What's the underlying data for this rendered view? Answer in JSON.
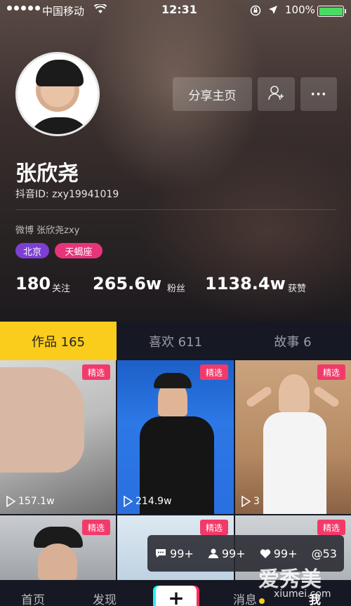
{
  "status_bar": {
    "carrier": "中国移动",
    "time": "12:31",
    "battery": "100%"
  },
  "profile": {
    "name": "张欣尧",
    "douyin_id": "抖音ID: zxy19941019",
    "weibo": "微博 张欣尧zxy",
    "tags": {
      "city": "北京",
      "zodiac": "天蝎座"
    },
    "share_label": "分享主页",
    "more_label": "···",
    "stats": {
      "following": {
        "value": "180",
        "label": "关注"
      },
      "followers": {
        "value": "265.6w",
        "label": "粉丝"
      },
      "likes": {
        "value": "1138.4w",
        "label": "获赞"
      }
    }
  },
  "tabs": {
    "works": "作品 165",
    "likes": "喜欢 611",
    "stories": "故事 6",
    "active": "works"
  },
  "grid": {
    "badge": "精选",
    "tiles": [
      {
        "plays": "157.1w"
      },
      {
        "plays": "214.9w"
      },
      {
        "plays": "3"
      },
      {
        "plays": ""
      },
      {
        "plays": ""
      },
      {
        "plays": ""
      }
    ]
  },
  "notice": {
    "comments": "99+",
    "fans": "99+",
    "likes": "99+",
    "mentions": "@53"
  },
  "bottom_nav": {
    "home": "首页",
    "discover": "发现",
    "plus": "+",
    "messages": "消息",
    "me": "我"
  },
  "watermark": {
    "text": "爱秀美",
    "url": "xiumei.com"
  },
  "colors": {
    "accent_yellow": "#facd1d",
    "badge_pink": "#f23a6a",
    "tag_purple": "#7d3fd1",
    "tag_pink": "#e6357a",
    "background": "#161823"
  }
}
